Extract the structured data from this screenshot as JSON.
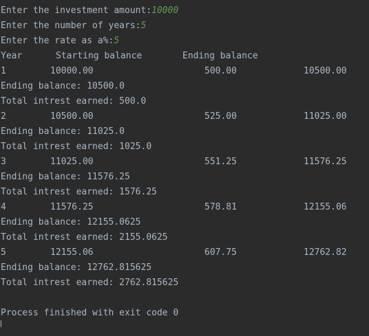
{
  "prompts": [
    {
      "label": "Enter the investment amount:",
      "value": "10000"
    },
    {
      "label": "Enter the number of years:",
      "value": "5"
    },
    {
      "label": "Enter the rate as a%:",
      "value": "5"
    }
  ],
  "header": {
    "year": "Year",
    "starting_balance": "Starting balance",
    "ending_balance": "Ending balance"
  },
  "rows": [
    {
      "year": "1",
      "start": "10000.00",
      "interest": "500.00",
      "end": "10500.00",
      "ending_line": "Ending balance: 10500.0",
      "total_line": "Total intrest earned: 500.0"
    },
    {
      "year": "2",
      "start": "10500.00",
      "interest": "525.00",
      "end": "11025.00",
      "ending_line": "Ending balance: 11025.0",
      "total_line": "Total intrest earned: 1025.0"
    },
    {
      "year": "3",
      "start": "11025.00",
      "interest": "551.25",
      "end": "11576.25",
      "ending_line": "Ending balance: 11576.25",
      "total_line": "Total intrest earned: 1576.25"
    },
    {
      "year": "4",
      "start": "11576.25",
      "interest": "578.81",
      "end": "12155.06",
      "ending_line": "Ending balance: 12155.0625",
      "total_line": "Total intrest earned: 2155.0625"
    },
    {
      "year": "5",
      "start": "12155.06",
      "interest": "607.75",
      "end": "12762.82",
      "ending_line": "Ending balance: 12762.815625",
      "total_line": "Total intrest earned: 2762.815625"
    }
  ],
  "exit_message": "Process finished with exit code 0",
  "colors": {
    "background": "#2b2b2b",
    "text": "#a9b7c6",
    "user_input": "#629755"
  }
}
